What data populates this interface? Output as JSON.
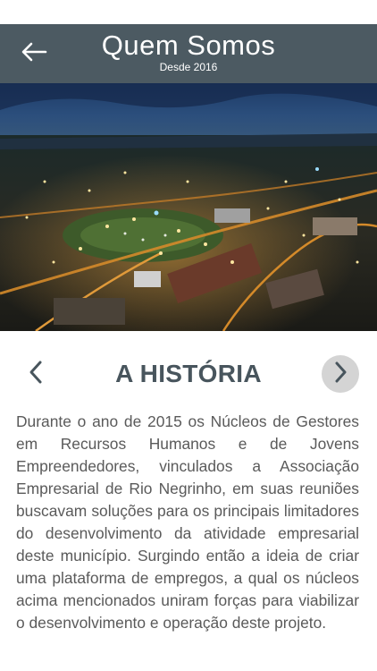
{
  "header": {
    "title": "Quem Somos",
    "subtitle": "Desde 2016",
    "back_icon": "arrow-left-icon",
    "background_color": "#4c5a62"
  },
  "hero": {
    "image": "aerial night city photo"
  },
  "section": {
    "title": "A HISTÓRIA",
    "prev_icon": "chevron-left-icon",
    "next_icon": "chevron-right-icon",
    "title_color": "#48555d"
  },
  "content": {
    "text": "Durante o ano de 2015 os Núcleos de Gestores em Recursos Humanos e de Jovens Empreendedores, vinculados a Associação Empresarial de Rio Negrinho, em suas reuniões buscavam soluções para os principais limitadores do desenvolvimento da atividade empresarial deste município. Surgindo então a ideia de criar uma plataforma de empregos, a qual os núcleos acima mencionados uniram forças para viabilizar o desenvolvimento e operação deste projeto."
  }
}
